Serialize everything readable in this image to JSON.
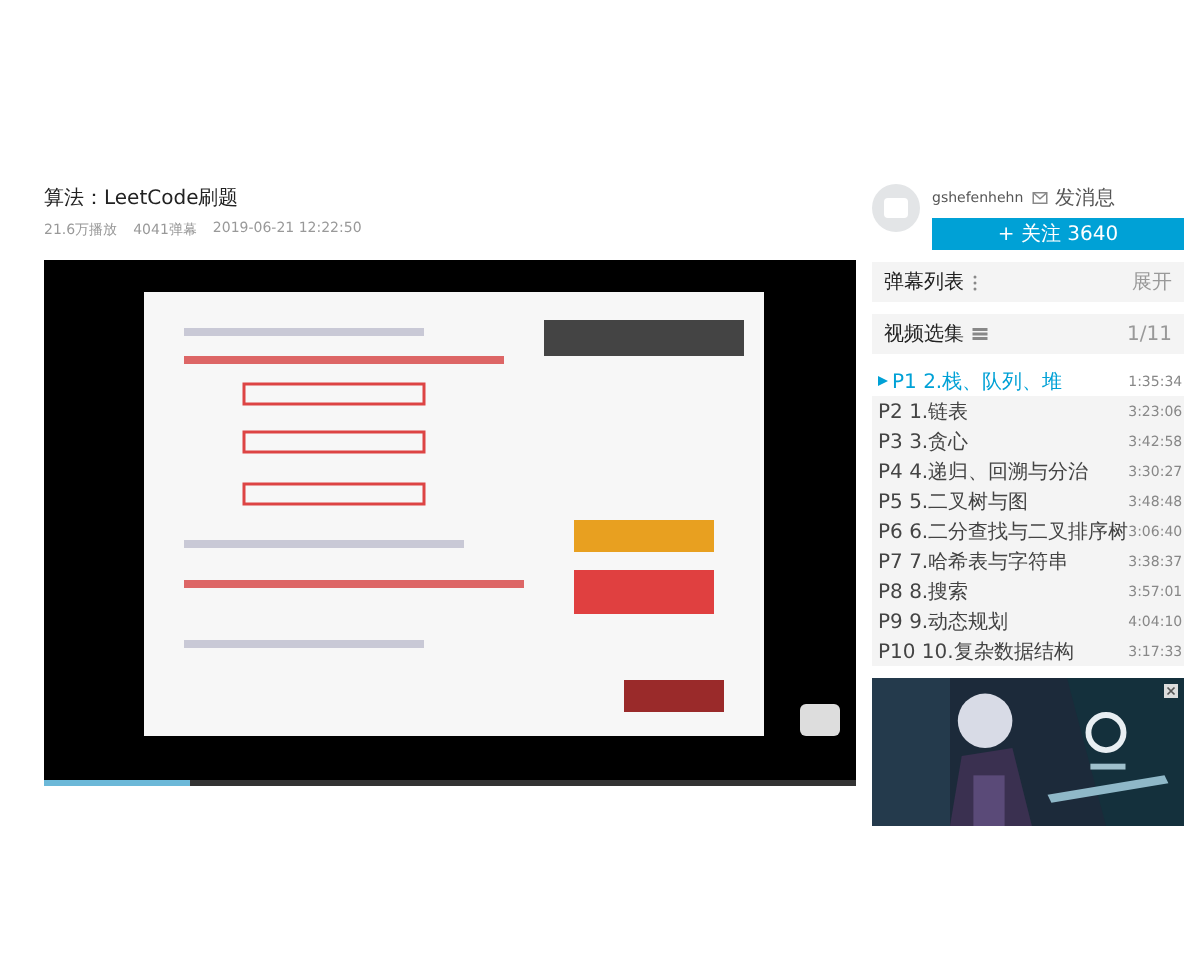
{
  "video": {
    "title": "算法：LeetCode刷题",
    "views": "21.6万播放",
    "danmaku_count": "4041弹幕",
    "date": "2019-06-21 12:22:50",
    "player": {
      "kind": "picture",
      "progress": {
        "level": 0.18
      }
    }
  },
  "uploader": {
    "name": "gshefenhehn",
    "message": "发消息",
    "follow": "+ 关注 3640"
  },
  "danmaku_panel": {
    "title": "弹幕列表",
    "expand": "展开"
  },
  "playlist": {
    "title": "视频选集",
    "count": "1/11",
    "items": [
      {
        "label": "P1",
        "title": "2.栈、队列、堆",
        "duration": "1:35:34",
        "selected": true
      },
      {
        "label": "P2",
        "title": "1.链表",
        "duration": "3:23:06",
        "selected": false
      },
      {
        "label": "P3",
        "title": "3.贪心",
        "duration": "3:42:58",
        "selected": false
      },
      {
        "label": "P4",
        "title": "4.递归、回溯与分治",
        "duration": "3:30:27",
        "selected": false
      },
      {
        "label": "P5",
        "title": "5.二叉树与图",
        "duration": "3:48:48",
        "selected": false
      },
      {
        "label": "P6",
        "title": "6.二分查找与二叉排序树",
        "duration": "3:06:40",
        "selected": false
      },
      {
        "label": "P7",
        "title": "7.哈希表与字符串",
        "duration": "3:38:37",
        "selected": false
      },
      {
        "label": "P8",
        "title": "8.搜索",
        "duration": "3:57:01",
        "selected": false
      },
      {
        "label": "P9",
        "title": "9.动态规划",
        "duration": "4:04:10",
        "selected": false
      },
      {
        "label": "P10",
        "title": "10.复杂数据结构",
        "duration": "3:17:33",
        "selected": false
      }
    ]
  }
}
